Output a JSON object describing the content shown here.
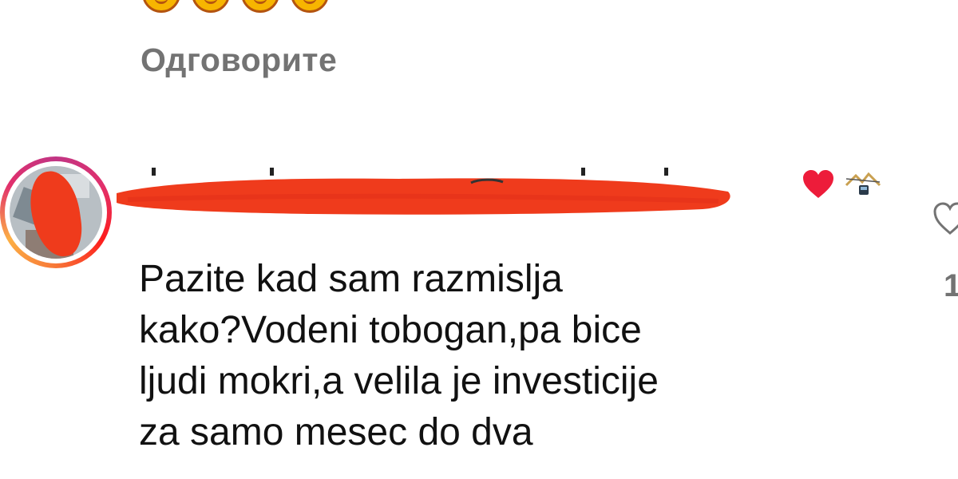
{
  "reactions": {
    "icons": [
      "laughing-emoji",
      "laughing-emoji",
      "laughing-emoji",
      "laughing-emoji"
    ]
  },
  "reply_label": "Одговорите",
  "comment": {
    "username": "",
    "text": "Pazite kad sam razmislja\nkako?Vodeni tobogan,pa bice\nljudi mokri,a velila je investicije\nza samo mesec do dva",
    "liked_by_author_icon": "heart-icon",
    "badge_icon": "cable-car-icon",
    "like_icon": "heart-outline-icon",
    "like_count": "1"
  },
  "colors": {
    "text": "#111111",
    "muted": "#737373",
    "heart": "#ed1c3a",
    "redaction": "#ef3b1c"
  }
}
